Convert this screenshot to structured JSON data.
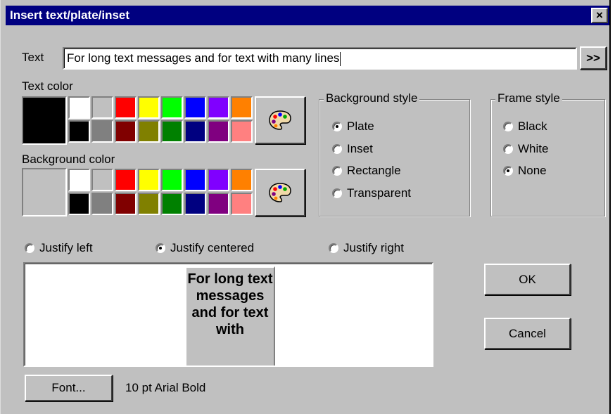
{
  "window": {
    "title": "Insert text/plate/inset",
    "close_label": "×"
  },
  "text_field": {
    "label": "Text",
    "value": "For long text messages and for text with many lines",
    "more_button_label": ">>"
  },
  "text_color": {
    "label": "Text color",
    "selected": "#000000",
    "swatches": [
      "#ffffff",
      "#c0c0c0",
      "#ff0000",
      "#ffff00",
      "#00ff00",
      "#0000ff",
      "#8000ff",
      "#ff8000",
      "#000000",
      "#808080",
      "#800000",
      "#808000",
      "#008000",
      "#000080",
      "#800080",
      "#ff8080"
    ],
    "palette_icon": "paint-palette-icon"
  },
  "background_color": {
    "label": "Background color",
    "selected": "#c0c0c0",
    "swatches": [
      "#ffffff",
      "#c0c0c0",
      "#ff0000",
      "#ffff00",
      "#00ff00",
      "#0000ff",
      "#8000ff",
      "#ff8000",
      "#000000",
      "#808080",
      "#800000",
      "#808000",
      "#008000",
      "#000080",
      "#800080",
      "#ff8080"
    ],
    "palette_icon": "paint-palette-icon"
  },
  "background_style": {
    "legend": "Background style",
    "options": [
      {
        "label": "Plate",
        "checked": true
      },
      {
        "label": "Inset",
        "checked": false
      },
      {
        "label": "Rectangle",
        "checked": false
      },
      {
        "label": "Transparent",
        "checked": false
      }
    ]
  },
  "frame_style": {
    "legend": "Frame style",
    "options": [
      {
        "label": "Black",
        "checked": false
      },
      {
        "label": "White",
        "checked": false
      },
      {
        "label": "None",
        "checked": true
      }
    ]
  },
  "justify": {
    "options": [
      {
        "label": "Justify left",
        "checked": false
      },
      {
        "label": "Justify centered",
        "checked": true
      },
      {
        "label": "Justify right",
        "checked": false
      }
    ]
  },
  "preview": {
    "text": "For long text messages and for text with"
  },
  "buttons": {
    "ok": "OK",
    "cancel": "Cancel",
    "font": "Font..."
  },
  "font_info": "10 pt Arial Bold"
}
